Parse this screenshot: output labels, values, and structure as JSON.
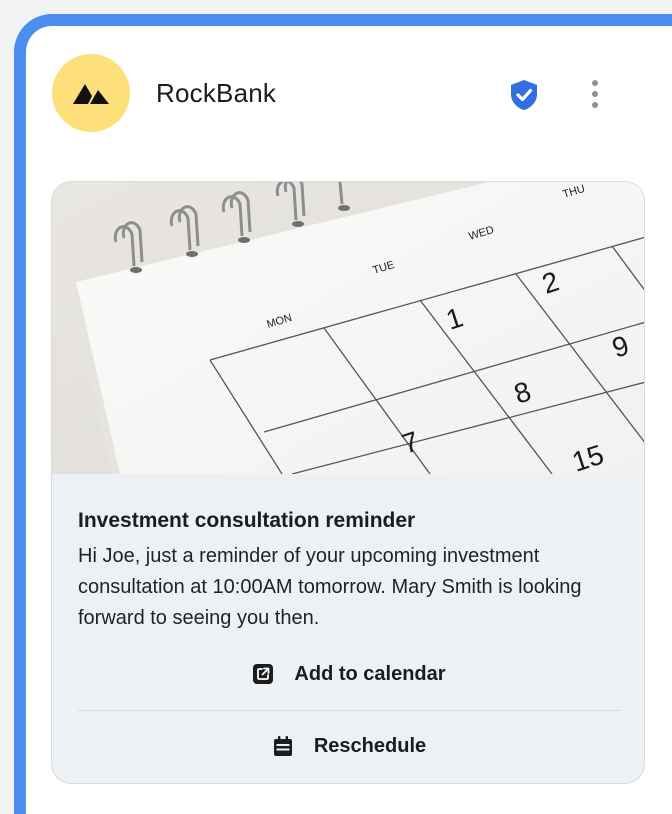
{
  "brand": {
    "name": "RockBank",
    "avatar_color": "#fde07a",
    "logo_icon": "mountain-logo-icon",
    "verified_icon": "verified-shield-icon",
    "verified_color": "#2f6fe0"
  },
  "header": {
    "menu_icon": "more-vertical-icon"
  },
  "card": {
    "image_icon": "calendar-photo",
    "calendar_days": [
      "MON",
      "TUE",
      "WED",
      "THU"
    ],
    "calendar_numbers": [
      "1",
      "2",
      "7",
      "8",
      "9",
      "15"
    ],
    "title": "Investment consultation reminder",
    "message": "Hi Joe, just a reminder of your upcoming investment consultation at 10:00AM tomorrow. Mary Smith is looking forward to seeing you then.",
    "actions": [
      {
        "label": "Add to calendar",
        "icon": "open-external-icon"
      },
      {
        "label": "Reschedule",
        "icon": "calendar-icon"
      }
    ]
  },
  "colors": {
    "accent_border": "#4a8ff0",
    "card_background": "#eef1f4"
  }
}
